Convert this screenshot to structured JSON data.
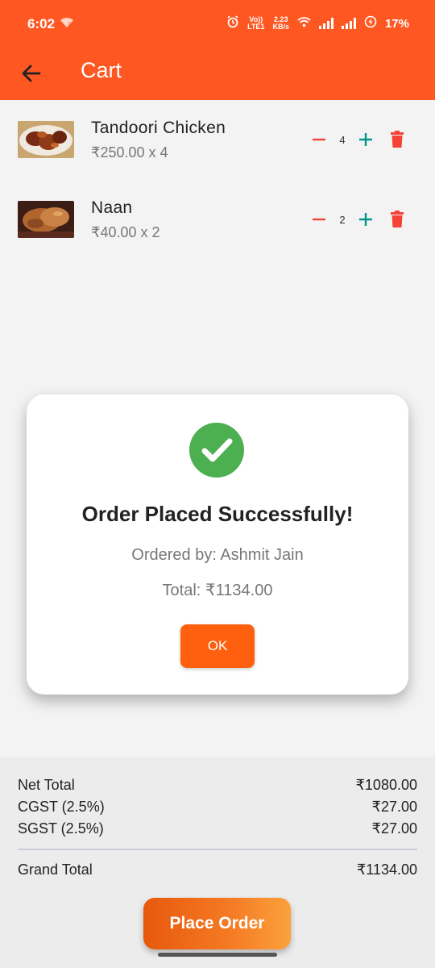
{
  "status_bar": {
    "time": "6:02",
    "volte_top": "Vo))",
    "volte_bottom": "LTE1",
    "speed_top": "2.23",
    "speed_bottom": "KB/s",
    "battery": "17%"
  },
  "app_bar": {
    "title": "Cart",
    "back_icon": "arrow-left-icon"
  },
  "cart": {
    "items": [
      {
        "name": "Tandoori Chicken",
        "price_line": "₹250.00 x 4",
        "quantity": "4"
      },
      {
        "name": "Naan",
        "price_line": "₹40.00 x 2",
        "quantity": "2"
      }
    ]
  },
  "dialog": {
    "icon": "check-circle-icon",
    "title": "Order Placed Successfully!",
    "ordered_by": "Ordered by: Ashmit Jain",
    "total": "Total: ₹1134.00",
    "ok_label": "OK"
  },
  "summary": {
    "net_total_label": "Net Total",
    "net_total_value": "₹1080.00",
    "cgst_label": "CGST (2.5%)",
    "cgst_value": "₹27.00",
    "sgst_label": "SGST (2.5%)",
    "sgst_value": "₹27.00",
    "grand_total_label": "Grand Total",
    "grand_total_value": "₹1134.00"
  },
  "place_order_label": "Place Order",
  "colors": {
    "primary": "#ff5722",
    "accent_minus": "#f44336",
    "accent_plus": "#009688",
    "success": "#4caf50"
  }
}
